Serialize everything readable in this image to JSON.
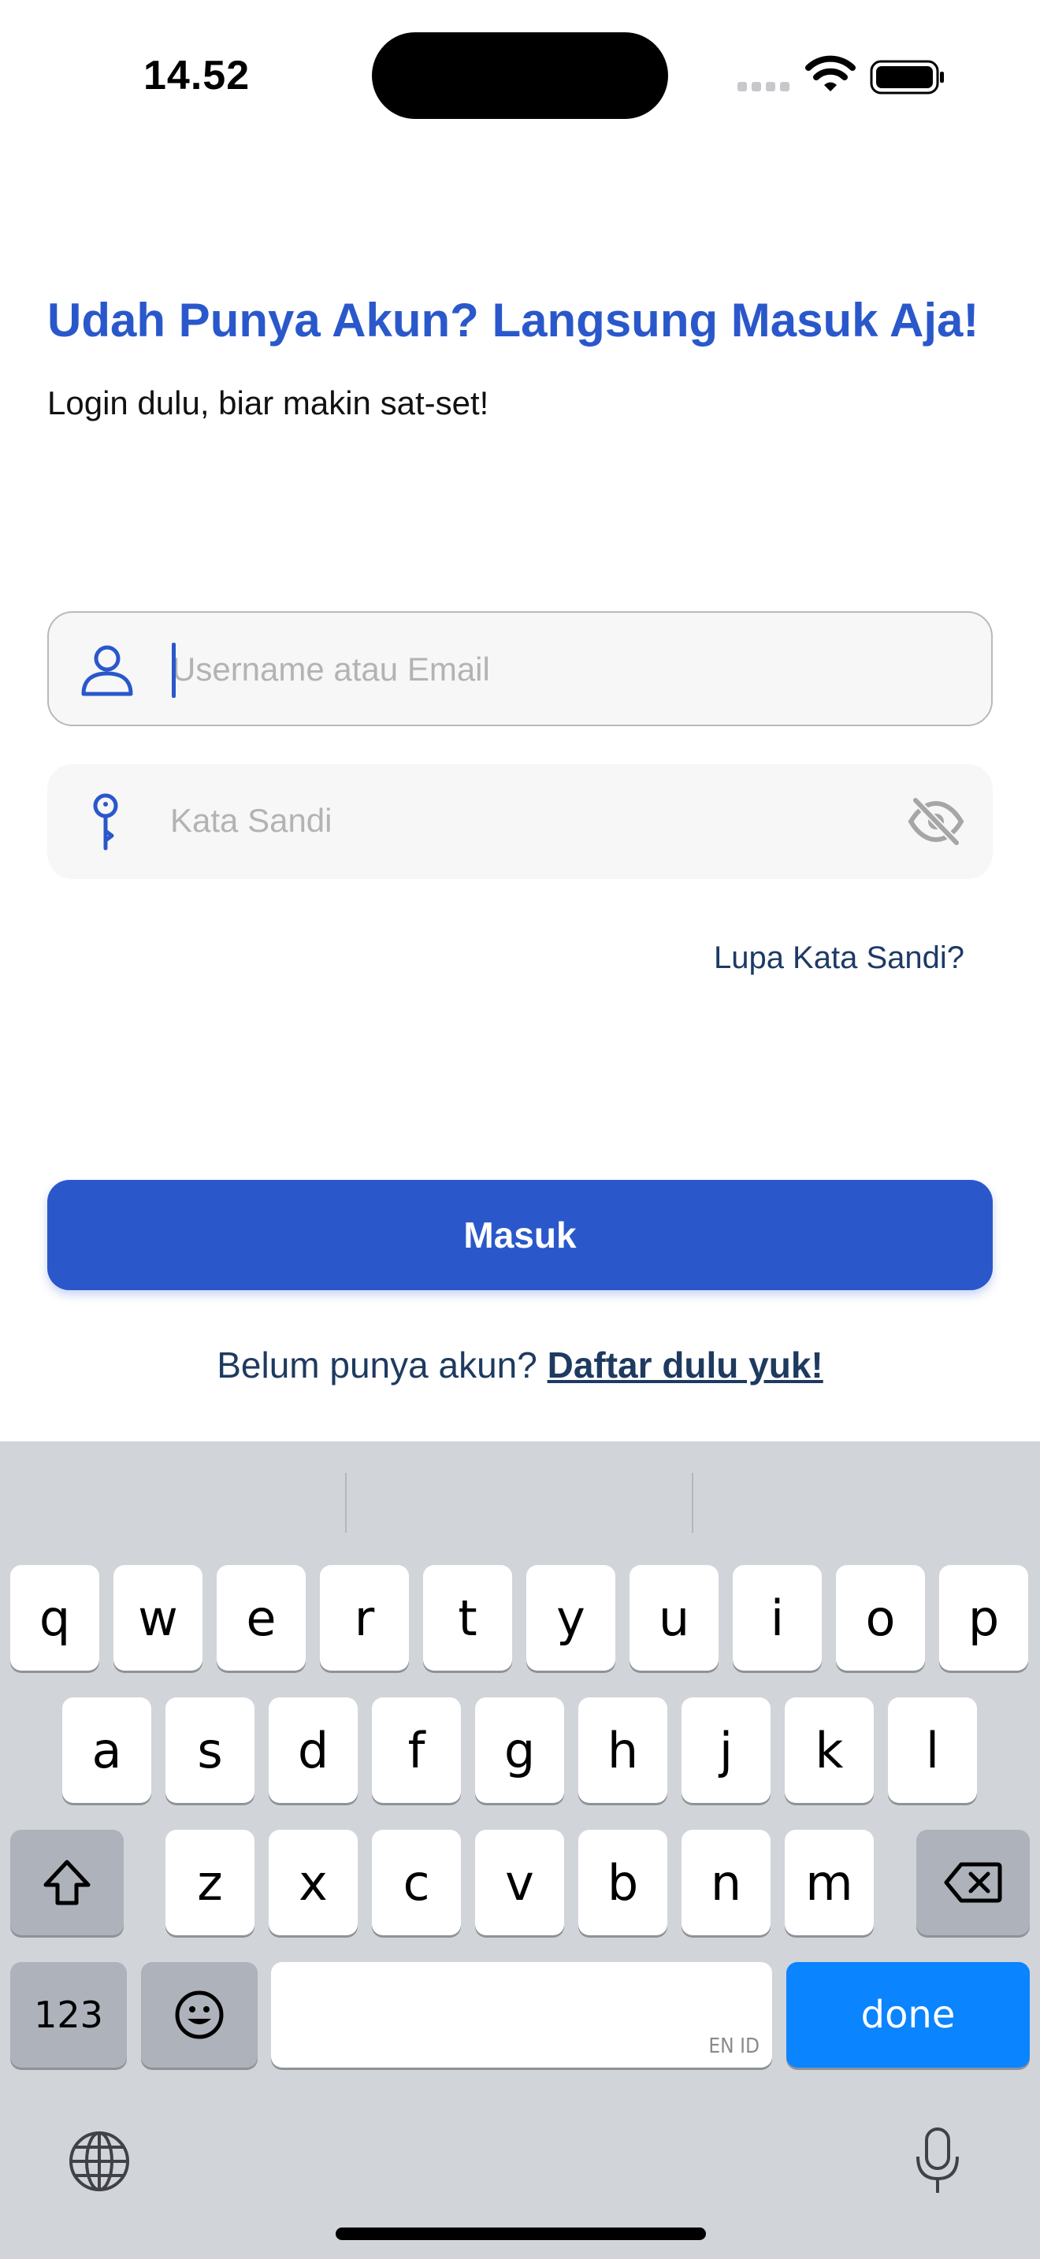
{
  "status_bar": {
    "time": "14.52"
  },
  "header": {
    "title": "Udah Punya Akun? Langsung Masuk Aja!",
    "subtitle": "Login dulu, biar makin sat-set!"
  },
  "form": {
    "username_placeholder": "Username atau Email",
    "password_placeholder": "Kata Sandi",
    "forgot_label": "Lupa Kata Sandi?",
    "login_label": "Masuk",
    "register_prompt": "Belum punya akun? ",
    "register_link": "Daftar dulu yuk!"
  },
  "keyboard": {
    "row1": [
      "q",
      "w",
      "e",
      "r",
      "t",
      "y",
      "u",
      "i",
      "o",
      "p"
    ],
    "row2": [
      "a",
      "s",
      "d",
      "f",
      "g",
      "h",
      "j",
      "k",
      "l"
    ],
    "row3": [
      "z",
      "x",
      "c",
      "v",
      "b",
      "n",
      "m"
    ],
    "numbers_label": "123",
    "done_label": "done",
    "space_hint": "EN ID",
    "shift_icon": "shift-icon",
    "delete_icon": "delete-icon",
    "emoji_icon": "emoji-icon",
    "globe_icon": "globe-icon",
    "mic_icon": "microphone-icon"
  },
  "colors": {
    "accent": "#2a58cb",
    "done_blue": "#0a84ff",
    "keyboard_bg": "#d1d4d9"
  }
}
